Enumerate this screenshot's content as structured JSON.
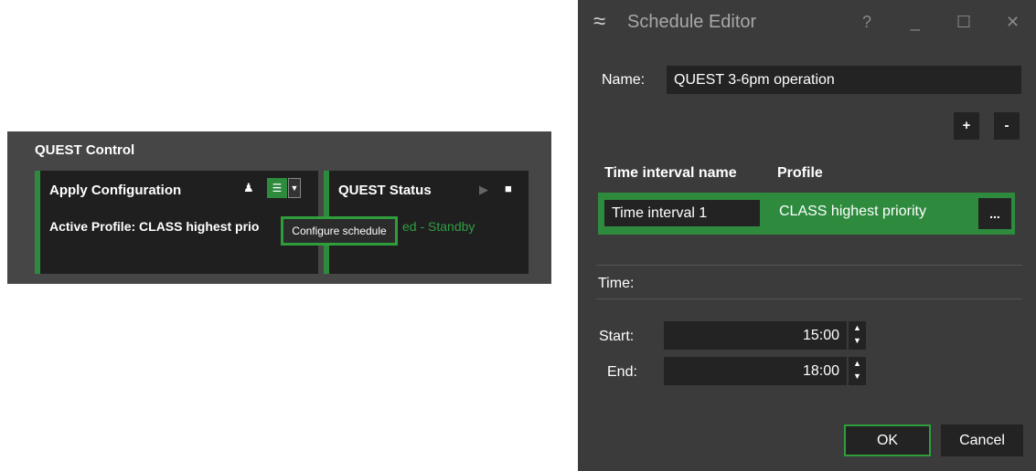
{
  "quest_control": {
    "title": "QUEST Control",
    "apply_card": {
      "title": "Apply Configuration",
      "active_profile": "Active Profile: CLASS highest prio",
      "tooltip": "Configure schedule"
    },
    "status_card": {
      "title": "QUEST Status",
      "status_text": "ed - Standby"
    }
  },
  "dialog": {
    "title": "Schedule Editor",
    "help": "?",
    "minimize": "_",
    "maximize": "☐",
    "close": "✕",
    "name_label": "Name:",
    "name_value": "QUEST 3-6pm operation",
    "add_label": "+",
    "remove_label": "-",
    "columns": [
      "Time interval name",
      "Profile"
    ],
    "interval": {
      "name": "Time interval 1",
      "profile": "CLASS highest priority",
      "browse_label": "..."
    },
    "time_label": "Time:",
    "start_label": "Start:",
    "start_value": "15:00",
    "end_label": "End:",
    "end_value": "18:00",
    "ok_label": "OK",
    "cancel_label": "Cancel"
  },
  "colors": {
    "accent": "#2e8b3e",
    "panel": "#464646",
    "dialog_bg": "#3b3b3b"
  }
}
